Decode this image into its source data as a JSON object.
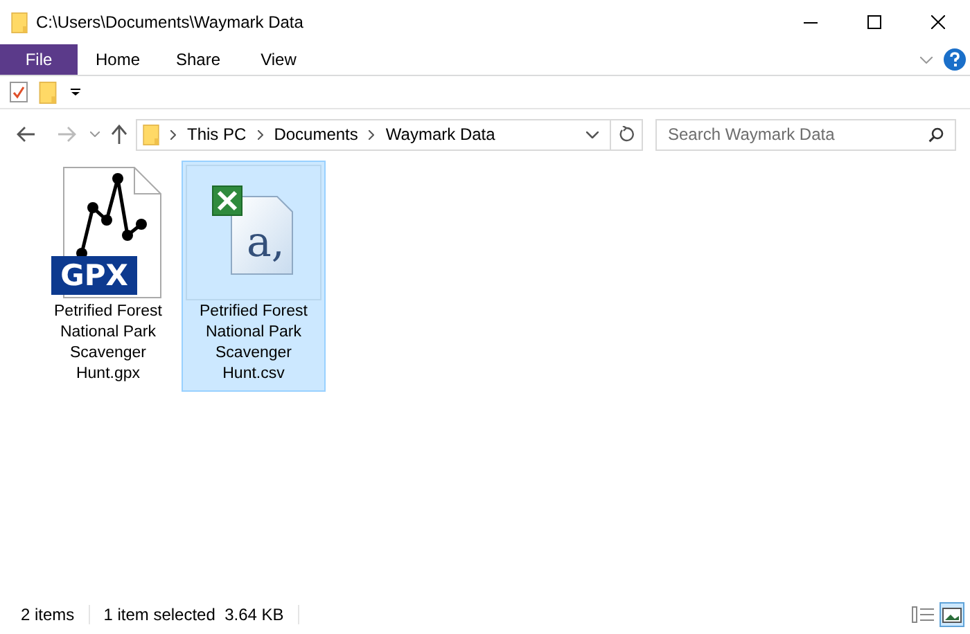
{
  "window": {
    "title": "C:\\Users\\Documents\\Waymark Data"
  },
  "ribbon_tabs": [
    {
      "label": "File",
      "selected": true
    },
    {
      "label": "Home",
      "selected": false
    },
    {
      "label": "Share",
      "selected": false
    },
    {
      "label": "View",
      "selected": false
    }
  ],
  "address": {
    "crumbs": [
      "This PC",
      "Documents",
      "Waymark Data"
    ]
  },
  "search": {
    "placeholder": "Search Waymark Data"
  },
  "files": [
    {
      "kind": "gpx",
      "name": "Petrified Forest National Park Scavenger Hunt.gpx",
      "badge": "GPX",
      "selected": false
    },
    {
      "kind": "csv",
      "name": "Petrified Forest National Park Scavenger Hunt.csv",
      "glyph": "a,",
      "selected": true
    }
  ],
  "status_bar": {
    "count": "2 items",
    "selection": "1 item selected  3.64 KB"
  },
  "views": [
    {
      "kind": "details",
      "selected": false
    },
    {
      "kind": "large_icons",
      "selected": true
    }
  ]
}
